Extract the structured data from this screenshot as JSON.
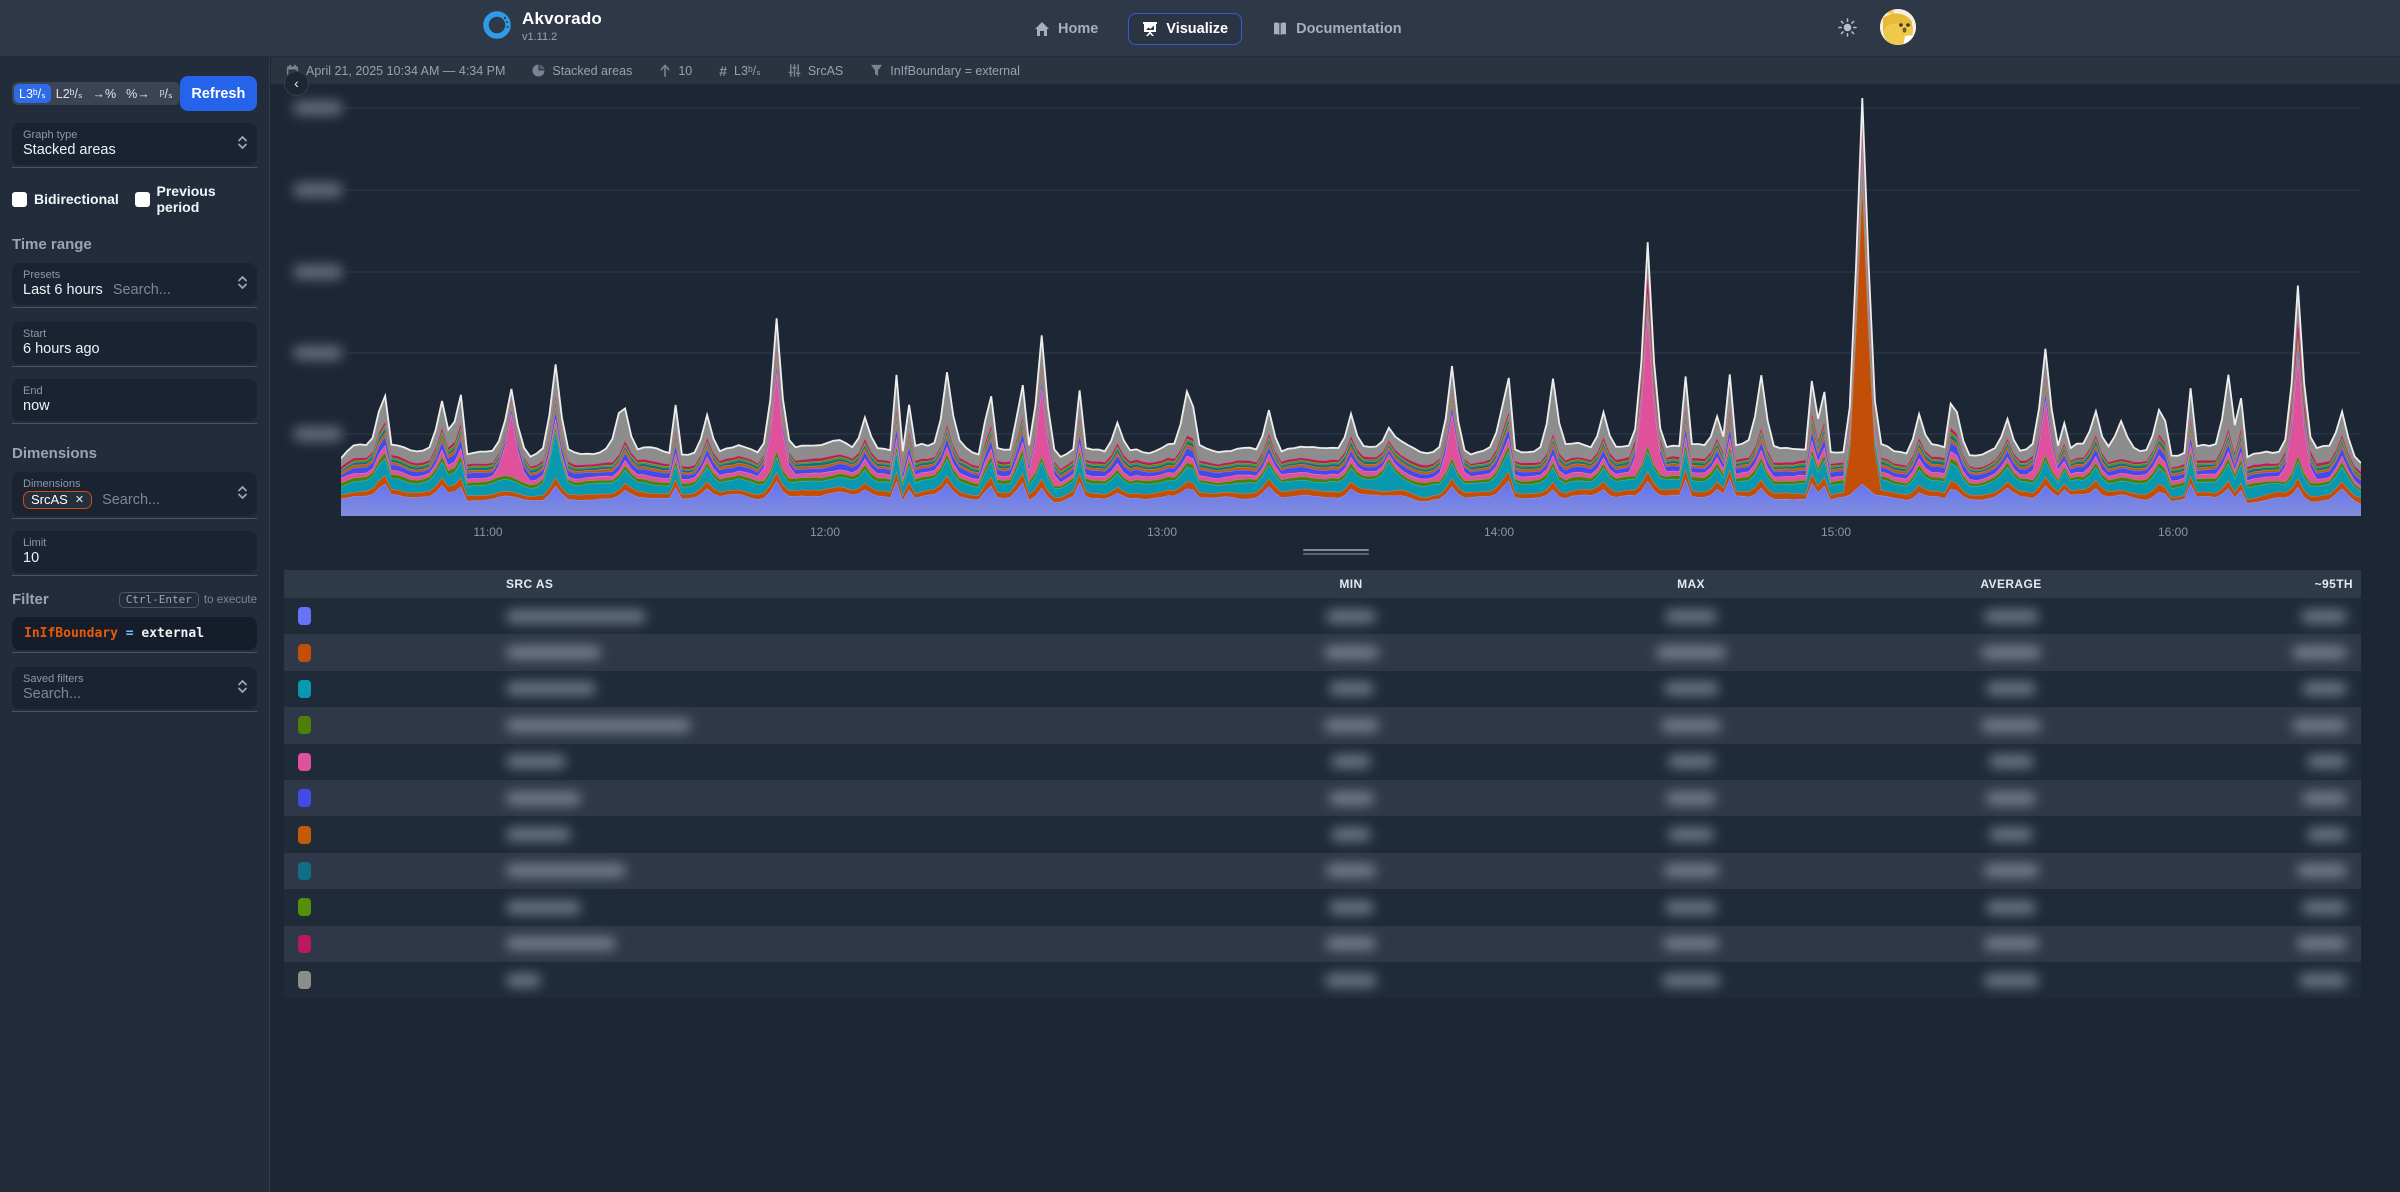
{
  "navbar": {
    "brand": "Akvorado",
    "version": "v1.11.2",
    "items": [
      {
        "label": "Home",
        "icon": "home-icon",
        "active": false
      },
      {
        "label": "Visualize",
        "icon": "presentation-chart-icon",
        "active": true
      },
      {
        "label": "Documentation",
        "icon": "book-icon",
        "active": false
      }
    ]
  },
  "breadcrumb": {
    "items": [
      {
        "icon": "calendar-icon",
        "label": "April 21, 2025 10:34 AM — 4:34 PM"
      },
      {
        "icon": "pie-chart-icon",
        "label": "Stacked areas"
      },
      {
        "icon": "arrow-up-icon",
        "label": "10"
      },
      {
        "icon": "hash-icon",
        "label": "L3ᵇ/ₛ"
      },
      {
        "icon": "sliders-icon",
        "label": "SrcAS"
      },
      {
        "icon": "funnel-icon",
        "label": "InIfBoundary = external"
      }
    ]
  },
  "sidebar": {
    "units": [
      {
        "label": "L3ᵇ/ₛ",
        "active": true
      },
      {
        "label": "L2ᵇ/ₛ",
        "active": false
      },
      {
        "label": "→%",
        "active": false
      },
      {
        "label": "%→",
        "active": false
      },
      {
        "label": "ᵖ/ₛ",
        "active": false
      }
    ],
    "refresh_label": "Refresh",
    "graph_type": {
      "label": "Graph type",
      "value": "Stacked areas"
    },
    "checkboxes": [
      {
        "label": "Bidirectional",
        "checked": false
      },
      {
        "label": "Previous period",
        "checked": false
      }
    ],
    "time_range_heading": "Time range",
    "presets": {
      "label": "Presets",
      "value": "Last 6 hours",
      "placeholder": "Search..."
    },
    "start": {
      "label": "Start",
      "value": "6 hours ago"
    },
    "end": {
      "label": "End",
      "value": "now"
    },
    "dimensions_heading": "Dimensions",
    "dimensions": {
      "label": "Dimensions",
      "chips": [
        {
          "label": "SrcAS",
          "remove": "✕"
        }
      ],
      "placeholder": "Search..."
    },
    "limit": {
      "label": "Limit",
      "value": "10"
    },
    "filter": {
      "heading": "Filter",
      "kbd": "Ctrl-Enter",
      "kbd_suffix": "to execute",
      "expression": [
        {
          "text": "InIfBoundary",
          "color": "#e8590c"
        },
        {
          "text": " = ",
          "color": "#74c0fc"
        },
        {
          "text": "external",
          "color": "#f1f3f5"
        }
      ]
    },
    "saved_filters": {
      "label": "Saved filters",
      "placeholder": "Search..."
    },
    "collapse_icon": "‹"
  },
  "chart_data": {
    "type": "stacked-area",
    "title": "",
    "x_axis": {
      "start": "10:34",
      "end": "16:34",
      "ticks": [
        "11:00",
        "12:00",
        "13:00",
        "14:00",
        "15:00",
        "16:00"
      ]
    },
    "y_axis": {
      "labels_redacted": true,
      "gridline_count": 5
    },
    "legend_position": "table-below",
    "seed": 1337,
    "layers": [
      {
        "name_redacted": true,
        "fill": "#6673f7",
        "stroke": null,
        "base": 22,
        "spikes": []
      },
      {
        "name_redacted": true,
        "fill": "#c24e08",
        "stroke": null,
        "base": 6,
        "spikes": [
          [
            0.754,
            340
          ]
        ]
      },
      {
        "name_redacted": true,
        "fill": "#0898b0",
        "stroke": null,
        "base": 12,
        "spikes": [
          [
            0.107,
            30
          ],
          [
            0.52,
            20
          ]
        ]
      },
      {
        "name_redacted": true,
        "fill": "#4e7f08",
        "stroke": null,
        "base": 4,
        "spikes": []
      },
      {
        "name_redacted": true,
        "fill": "#e0519c",
        "stroke": null,
        "base": 5,
        "spikes": [
          [
            0.083,
            60
          ],
          [
            0.216,
            72
          ],
          [
            0.347,
            62
          ],
          [
            0.551,
            38
          ],
          [
            0.647,
            125
          ],
          [
            0.845,
            48
          ],
          [
            0.969,
            92
          ]
        ]
      },
      {
        "name_redacted": true,
        "fill": "#434ae8",
        "stroke": null,
        "base": 6,
        "spikes": []
      },
      {
        "name_redacted": true,
        "fill": "#c25a08",
        "stroke": null,
        "base": 3,
        "spikes": []
      },
      {
        "name_redacted": true,
        "fill": "#106e85",
        "stroke": null,
        "base": 3,
        "spikes": []
      },
      {
        "name_redacted": true,
        "fill": "#549008",
        "stroke": null,
        "base": 2,
        "spikes": []
      },
      {
        "name_redacted": true,
        "fill": "#bb1a5c",
        "stroke": null,
        "base": 3,
        "spikes": [
          [
            0.647,
            18
          ],
          [
            0.969,
            14
          ]
        ]
      },
      {
        "name_redacted": true,
        "fill": "#8d8d8d",
        "stroke": "#ededed",
        "base": 14,
        "spikes": [
          [
            0.138,
            28
          ],
          [
            0.3,
            26
          ],
          [
            0.42,
            22
          ],
          [
            0.6,
            30
          ],
          [
            0.704,
            24
          ],
          [
            0.88,
            26
          ],
          [
            0.935,
            30
          ]
        ]
      }
    ],
    "common_spikes": [
      [
        0.02,
        0.5
      ],
      [
        0.05,
        0.8
      ],
      [
        0.107,
        1.1
      ],
      [
        0.14,
        0.6
      ],
      [
        0.18,
        0.7
      ],
      [
        0.216,
        1.0
      ],
      [
        0.26,
        0.6
      ],
      [
        0.3,
        0.9
      ],
      [
        0.347,
        1.1
      ],
      [
        0.385,
        0.6
      ],
      [
        0.42,
        0.7
      ],
      [
        0.46,
        0.8
      ],
      [
        0.5,
        0.7
      ],
      [
        0.551,
        1.0
      ],
      [
        0.575,
        0.8
      ],
      [
        0.6,
        0.9
      ],
      [
        0.625,
        0.7
      ],
      [
        0.647,
        1.2
      ],
      [
        0.68,
        0.6
      ],
      [
        0.704,
        0.9
      ],
      [
        0.73,
        0.6
      ],
      [
        0.754,
        1.3
      ],
      [
        0.78,
        0.7
      ],
      [
        0.8,
        0.8
      ],
      [
        0.825,
        0.6
      ],
      [
        0.845,
        1.0
      ],
      [
        0.87,
        0.7
      ],
      [
        0.9,
        0.8
      ],
      [
        0.935,
        0.9
      ],
      [
        0.969,
        1.2
      ],
      [
        0.99,
        0.7
      ]
    ]
  },
  "table": {
    "headers": [
      "SRC AS",
      "MIN",
      "MAX",
      "AVERAGE",
      "~95TH"
    ],
    "values_redacted": true,
    "rows": [
      {
        "color": "#6673f7",
        "w_name": 140,
        "w_min": 50,
        "w_max": 52,
        "w_avg": 55,
        "w_p95": 46
      },
      {
        "color": "#c24e08",
        "w_name": 95,
        "w_min": 55,
        "w_max": 70,
        "w_avg": 60,
        "w_p95": 55
      },
      {
        "color": "#0898b0",
        "w_name": 90,
        "w_min": 45,
        "w_max": 55,
        "w_avg": 50,
        "w_p95": 45
      },
      {
        "color": "#4e7f08",
        "w_name": 185,
        "w_min": 55,
        "w_max": 60,
        "w_avg": 60,
        "w_p95": 55
      },
      {
        "color": "#e0519c",
        "w_name": 60,
        "w_min": 40,
        "w_max": 47,
        "w_avg": 45,
        "w_p95": 40
      },
      {
        "color": "#434ae8",
        "w_name": 75,
        "w_min": 45,
        "w_max": 50,
        "w_avg": 50,
        "w_p95": 45
      },
      {
        "color": "#c25a08",
        "w_name": 65,
        "w_min": 40,
        "w_max": 46,
        "w_avg": 44,
        "w_p95": 40
      },
      {
        "color": "#106e85",
        "w_name": 120,
        "w_min": 50,
        "w_max": 55,
        "w_avg": 55,
        "w_p95": 50
      },
      {
        "color": "#549008",
        "w_name": 75,
        "w_min": 45,
        "w_max": 52,
        "w_avg": 50,
        "w_p95": 45
      },
      {
        "color": "#bb1a5c",
        "w_name": 110,
        "w_min": 50,
        "w_max": 56,
        "w_avg": 55,
        "w_p95": 50
      },
      {
        "color": "#8d8d8d",
        "w_name": 35,
        "w_min": 52,
        "w_max": 58,
        "w_avg": 55,
        "w_p95": 48
      }
    ]
  },
  "theme": {
    "accent_blue": "#2563eb",
    "active_unit_blue": "#2e6be6",
    "chip_border_orange": "#d9480f",
    "navbar_bg": "#2f3847",
    "sidebar_bg": "#222c3a",
    "main_bg": "#1c2634",
    "row_odd": "#202b39",
    "row_even": "#2e3848",
    "logo_ring_blue": "#2f9be8"
  }
}
